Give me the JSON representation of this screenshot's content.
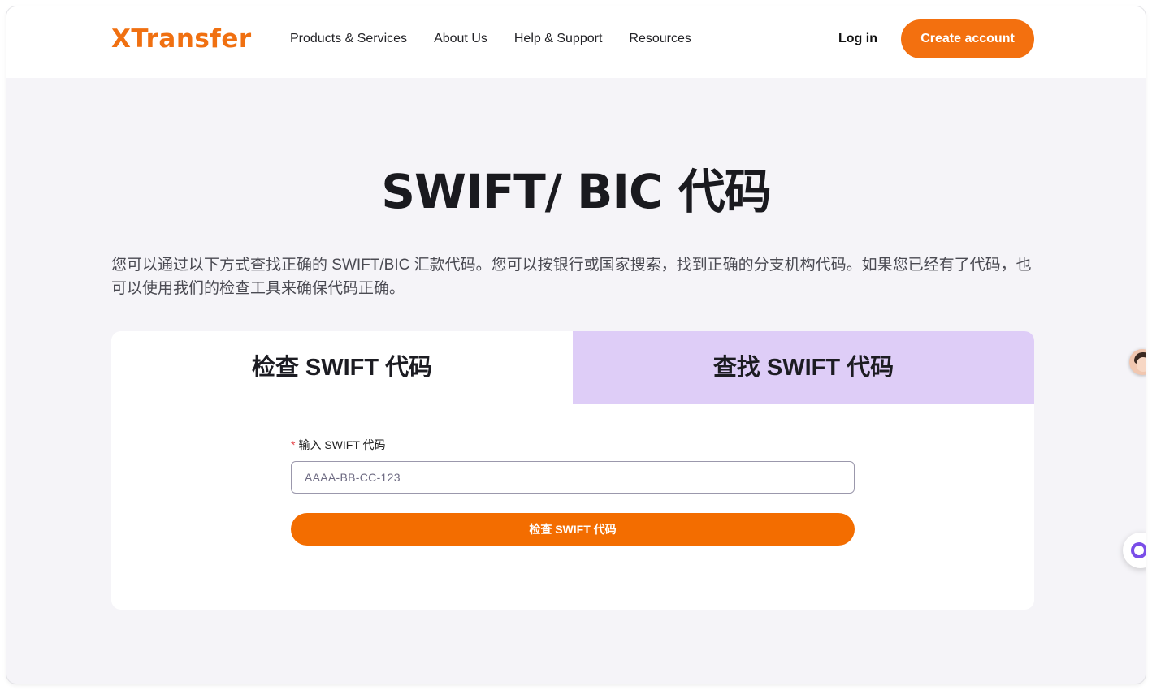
{
  "nav": {
    "logo": "XTransfer",
    "links": [
      "Products & Services",
      "About Us",
      "Help & Support",
      "Resources"
    ],
    "login": "Log in",
    "create_account": "Create account"
  },
  "hero": {
    "title": "SWIFT/ BIC 代码",
    "intro": "您可以通过以下方式查找正确的 SWIFT/BIC 汇款代码。您可以按银行或国家搜索，找到正确的分支机构代码。如果您已经有了代码，也可以使用我们的检查工具来确保代码正确。"
  },
  "card": {
    "tabs": [
      "检查 SWIFT 代码",
      "查找 SWIFT 代码"
    ],
    "active_tab": "检查 SWIFT 代码",
    "field_required_mark": "*",
    "field_label": "输入 SWIFT 代码",
    "field_placeholder": "AAAA-BB-CC-123",
    "field_value": "",
    "submit": "检查 SWIFT 代码"
  },
  "colors": {
    "brand": "#f3700f",
    "tab_inactive": "#decdf7",
    "page_bg": "#f5f4f8"
  },
  "floating": {
    "avatar_icon": "support-agent-avatar",
    "chat_icon": "chat-widget-icon"
  }
}
